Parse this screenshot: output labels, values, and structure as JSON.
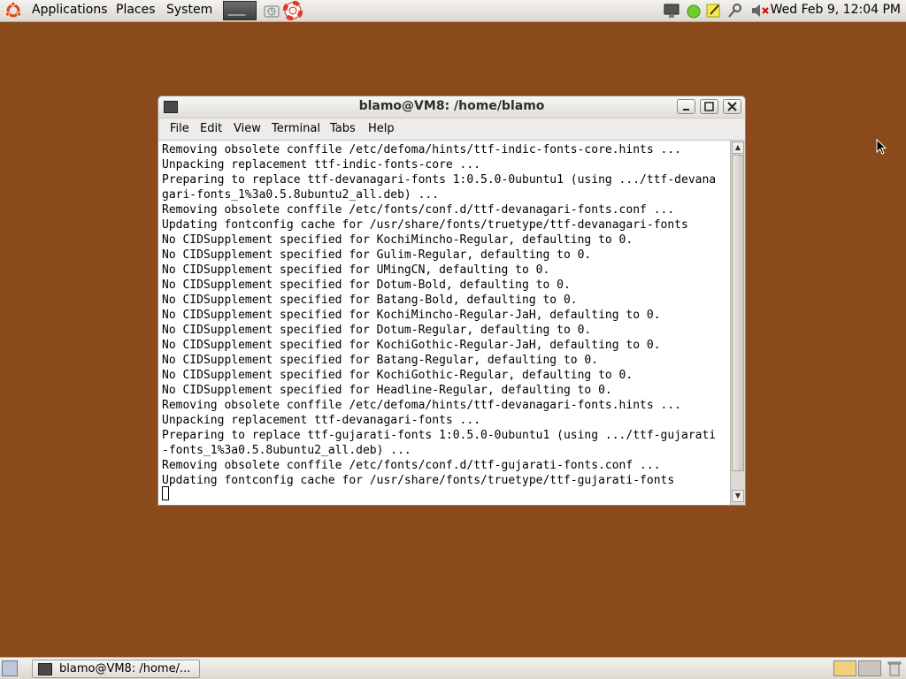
{
  "top_panel": {
    "menus": [
      "Applications",
      "Places",
      "System"
    ],
    "clock": "Wed Feb  9, 12:04 PM"
  },
  "window": {
    "title": "blamo@VM8: /home/blamo",
    "menu": [
      "File",
      "Edit",
      "View",
      "Terminal",
      "Tabs",
      "Help"
    ],
    "lines": [
      "Removing obsolete conffile /etc/defoma/hints/ttf-indic-fonts-core.hints ...",
      "Unpacking replacement ttf-indic-fonts-core ...",
      "Preparing to replace ttf-devanagari-fonts 1:0.5.0-0ubuntu1 (using .../ttf-devana",
      "gari-fonts_1%3a0.5.8ubuntu2_all.deb) ...",
      "Removing obsolete conffile /etc/fonts/conf.d/ttf-devanagari-fonts.conf ...",
      "Updating fontconfig cache for /usr/share/fonts/truetype/ttf-devanagari-fonts",
      "No CIDSupplement specified for KochiMincho-Regular, defaulting to 0.",
      "No CIDSupplement specified for Gulim-Regular, defaulting to 0.",
      "No CIDSupplement specified for UMingCN, defaulting to 0.",
      "No CIDSupplement specified for Dotum-Bold, defaulting to 0.",
      "No CIDSupplement specified for Batang-Bold, defaulting to 0.",
      "No CIDSupplement specified for KochiMincho-Regular-JaH, defaulting to 0.",
      "No CIDSupplement specified for Dotum-Regular, defaulting to 0.",
      "No CIDSupplement specified for KochiGothic-Regular-JaH, defaulting to 0.",
      "No CIDSupplement specified for Batang-Regular, defaulting to 0.",
      "No CIDSupplement specified for KochiGothic-Regular, defaulting to 0.",
      "No CIDSupplement specified for Headline-Regular, defaulting to 0.",
      "Removing obsolete conffile /etc/defoma/hints/ttf-devanagari-fonts.hints ...",
      "Unpacking replacement ttf-devanagari-fonts ...",
      "Preparing to replace ttf-gujarati-fonts 1:0.5.0-0ubuntu1 (using .../ttf-gujarati",
      "-fonts_1%3a0.5.8ubuntu2_all.deb) ...",
      "Removing obsolete conffile /etc/fonts/conf.d/ttf-gujarati-fonts.conf ...",
      "Updating fontconfig cache for /usr/share/fonts/truetype/ttf-gujarati-fonts"
    ]
  },
  "taskbar": {
    "task_label": "blamo@VM8: /home/..."
  },
  "colors": {
    "desktop": "#8b4a1b"
  }
}
